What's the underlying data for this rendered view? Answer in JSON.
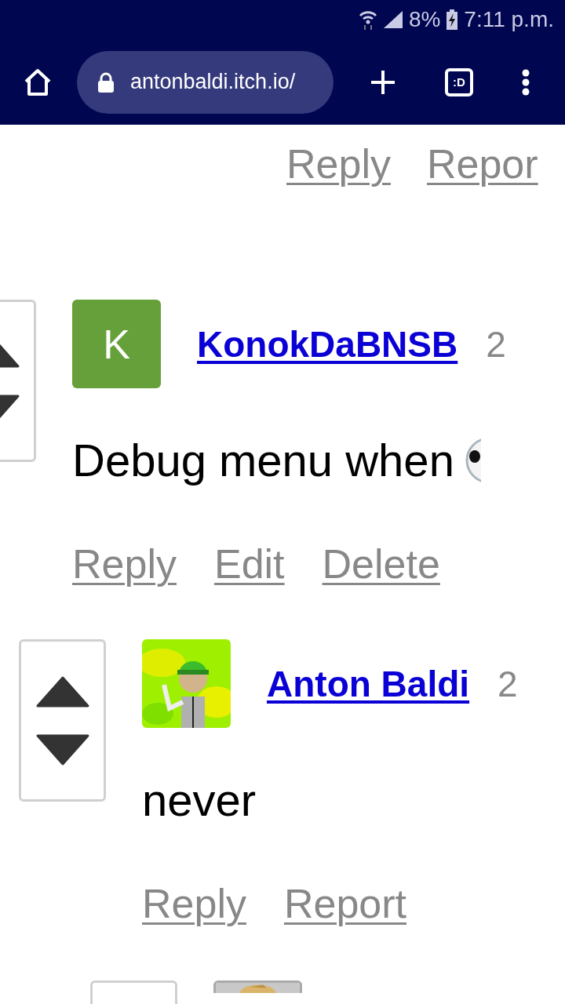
{
  "status_bar": {
    "battery": "8%",
    "time": "7:11 p.m."
  },
  "browser": {
    "url": "antonbaldi.itch.io/",
    "tab_count": ":D"
  },
  "top_actions": [
    "Reply",
    "Repor"
  ],
  "comments": [
    {
      "author": "KonokDaBNSB",
      "date": "2",
      "avatar": {
        "kind": "letter",
        "letter": "K",
        "color": "#66a03a"
      },
      "body": "Debug menu when",
      "emoji": true,
      "actions": [
        "Reply",
        "Edit",
        "Delete"
      ],
      "children": [
        {
          "author": "Anton Baldi",
          "date": "2",
          "avatar": {
            "kind": "picture"
          },
          "body": "never",
          "actions": [
            "Reply",
            "Report"
          ]
        }
      ]
    }
  ],
  "next_comment": {
    "avatar": {
      "kind": "picture"
    }
  }
}
